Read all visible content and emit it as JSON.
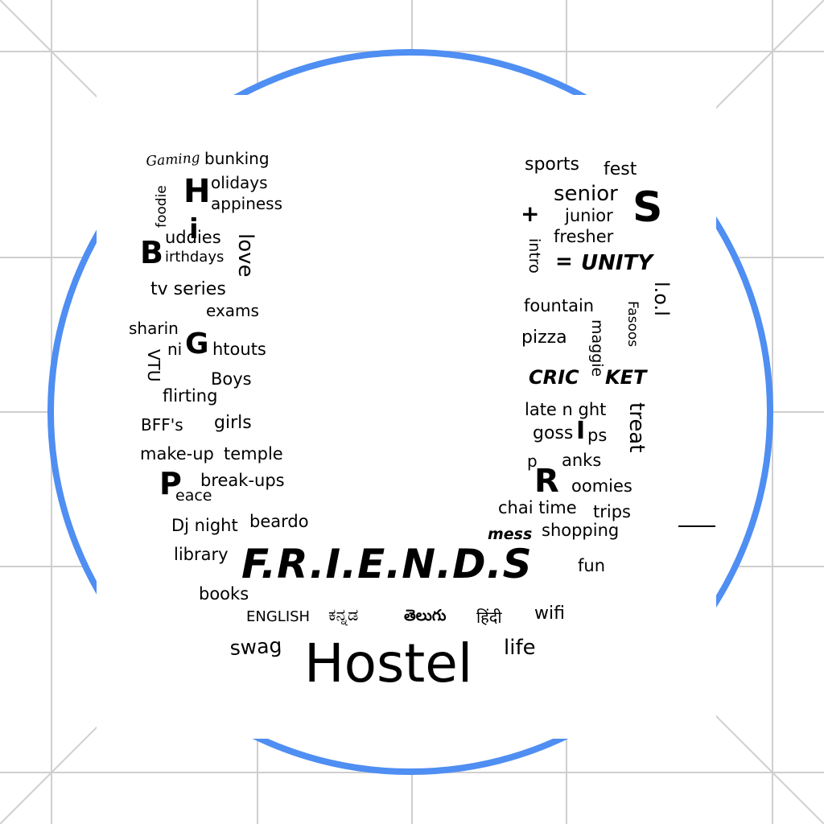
{
  "colors": {
    "background": "#ffffff",
    "grid_line": "#cfcfcf",
    "ring": "#4f8ef2",
    "badge_fill": "#e5edfc",
    "ink": "#000000"
  },
  "left_column": {
    "gaming": "Gaming",
    "bunking": "bunking",
    "H": "H",
    "olidays": "olidays",
    "appiness": "appiness",
    "foodie": "foodie",
    "i": "i",
    "uddies": "uddies",
    "B": "B",
    "irthdays": "irthdays",
    "love": "love",
    "tv_series": "tv series",
    "exams": "exams",
    "sharin": "sharin",
    "ni": "ni",
    "G": "G",
    "htouts": "htouts",
    "vtu": "VTU",
    "boys": "Boys",
    "flirting": "flirting",
    "bffs": "BFF's",
    "girls": "girls",
    "make_up": "make-up",
    "temple": "temple",
    "P": "P",
    "eace": "eace",
    "break_ups": "break-ups",
    "dj_night": "Dj night",
    "beardo": "beardo",
    "library": "library",
    "books": "books"
  },
  "right_column": {
    "sports": "sports",
    "fest": "fest",
    "senior": "senior",
    "S": "S",
    "plus": "+",
    "junior": "junior",
    "fresher": "fresher",
    "intro": "intro",
    "equals": "=",
    "unity": "UNITY",
    "lol": "l.o.l",
    "fountain": "fountain",
    "fasoos": "Fasoos",
    "pizza": "pizza",
    "maggie": "maggie",
    "cric": "CRIC",
    "ket": "KET",
    "late_night": "late n ght",
    "treat": "treat",
    "gossips_pre": "goss",
    "gossips_i": "I",
    "gossips_post": "ps",
    "p_small": "p",
    "ranks": "anks",
    "R": "R",
    "oomies": "oomies",
    "chai_time": "chai time",
    "trips": "trips",
    "mess": "mess",
    "shopping": "shopping",
    "fun": "fun"
  },
  "bottom": {
    "friends": "F.R.I.E.N.D.S",
    "english": "ENGLISH",
    "kannada": "ಕನ್ನಡ",
    "telugu": "తెలుగు",
    "hindi": "हिंदी",
    "wifi": "wifi",
    "swag": "swag",
    "hostel": "Hostel",
    "life": "life"
  }
}
